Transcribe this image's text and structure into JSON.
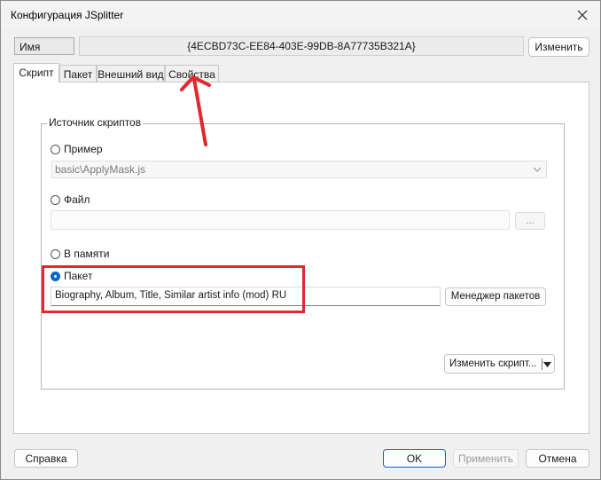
{
  "window": {
    "title": "Конфигурация JSplitter",
    "close_icon": "close-icon"
  },
  "header": {
    "name_label": "Имя",
    "guid_value": "{4ECBD73C-EE84-403E-99DB-8A77735B321A}",
    "rename_button": "Изменить"
  },
  "tabs": [
    {
      "label": "Скрипт",
      "active": true
    },
    {
      "label": "Пакет",
      "active": false
    },
    {
      "label": "Внешний вид",
      "active": false
    },
    {
      "label": "Свойства",
      "active": false
    }
  ],
  "script_source": {
    "group_title": "Источник скриптов",
    "options": {
      "sample": {
        "label": "Пример",
        "checked": false
      },
      "file": {
        "label": "Файл",
        "checked": false
      },
      "memory": {
        "label": "В памяти",
        "checked": false
      },
      "package": {
        "label": "Пакет",
        "checked": true
      }
    },
    "sample_combo_value": "basic\\ApplyMask.js",
    "file_path_value": "",
    "browse_button": "...",
    "package_value": "Biography, Album, Title, Similar artist info (mod) RU",
    "package_manager_button": "Менеджер пакетов",
    "change_script_button": "Изменить скрипт..."
  },
  "footer": {
    "help_button": "Справка",
    "ok_button": "OK",
    "apply_button": "Применить",
    "cancel_button": "Отмена"
  },
  "annotations": {
    "highlight_color": "#e0292c"
  }
}
